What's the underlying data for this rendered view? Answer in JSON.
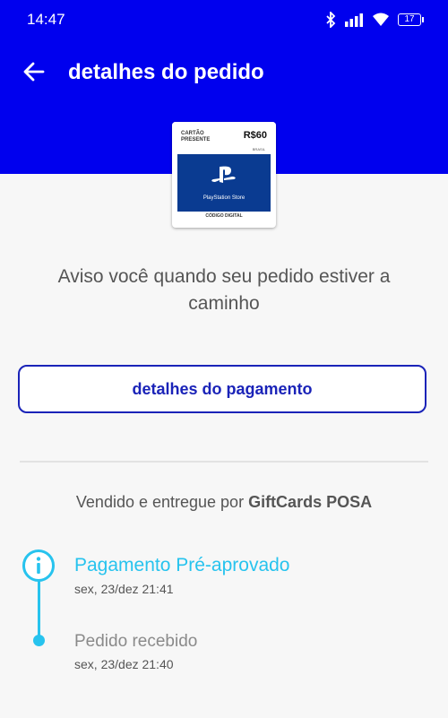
{
  "status": {
    "time": "14:47",
    "battery": "17"
  },
  "header": {
    "title": "detalhes do pedido"
  },
  "product": {
    "tag": "CARTÃO PRESENTE",
    "price": "R$60",
    "region": "BRASIL",
    "store": "PlayStation Store",
    "code_label": "CÓDIGO DIGITAL"
  },
  "notice": "Aviso você quando seu pedido estiver a caminho",
  "payment_button": "detalhes do pagamento",
  "seller": {
    "prefix": "Vendido e entregue por ",
    "name": "GiftCards POSA"
  },
  "timeline": [
    {
      "title": "Pagamento Pré-aprovado",
      "date": "sex, 23/dez 21:41"
    },
    {
      "title": "Pedido recebido",
      "date": "sex, 23/dez 21:40"
    }
  ],
  "colors": {
    "brand": "#0000ee",
    "accent": "#27c3ee",
    "button": "#1a23b8"
  },
  "icons": [
    "bluetooth-icon",
    "signal-icon",
    "wifi-icon",
    "battery-icon",
    "back-arrow-icon",
    "playstation-logo-icon",
    "info-icon"
  ]
}
